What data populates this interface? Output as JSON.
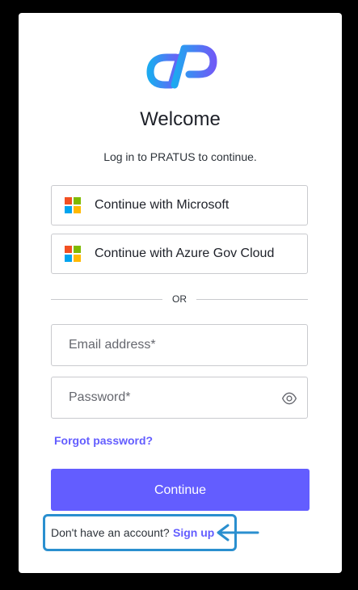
{
  "header": {
    "title": "Welcome",
    "subtitle": "Log in to PRATUS to continue."
  },
  "sso": {
    "microsoft_label": "Continue with Microsoft",
    "azure_label": "Continue with Azure Gov Cloud"
  },
  "divider": {
    "text": "OR"
  },
  "form": {
    "email_placeholder": "Email address*",
    "email_value": "",
    "password_placeholder": "Password*",
    "password_value": "",
    "forgot_label": "Forgot password?",
    "continue_label": "Continue"
  },
  "footer": {
    "prompt": "Don't have an account?",
    "signup_label": "Sign up"
  },
  "icons": {
    "logo": "pratus-logo",
    "microsoft": "microsoft-icon",
    "show_password": "eye-icon",
    "annotation": "arrow-left-icon"
  },
  "colors": {
    "accent": "#635dff",
    "annotation": "#2a8fcf",
    "logo_gradient_start": "#1da9f0",
    "logo_gradient_end": "#6e5cf6"
  }
}
